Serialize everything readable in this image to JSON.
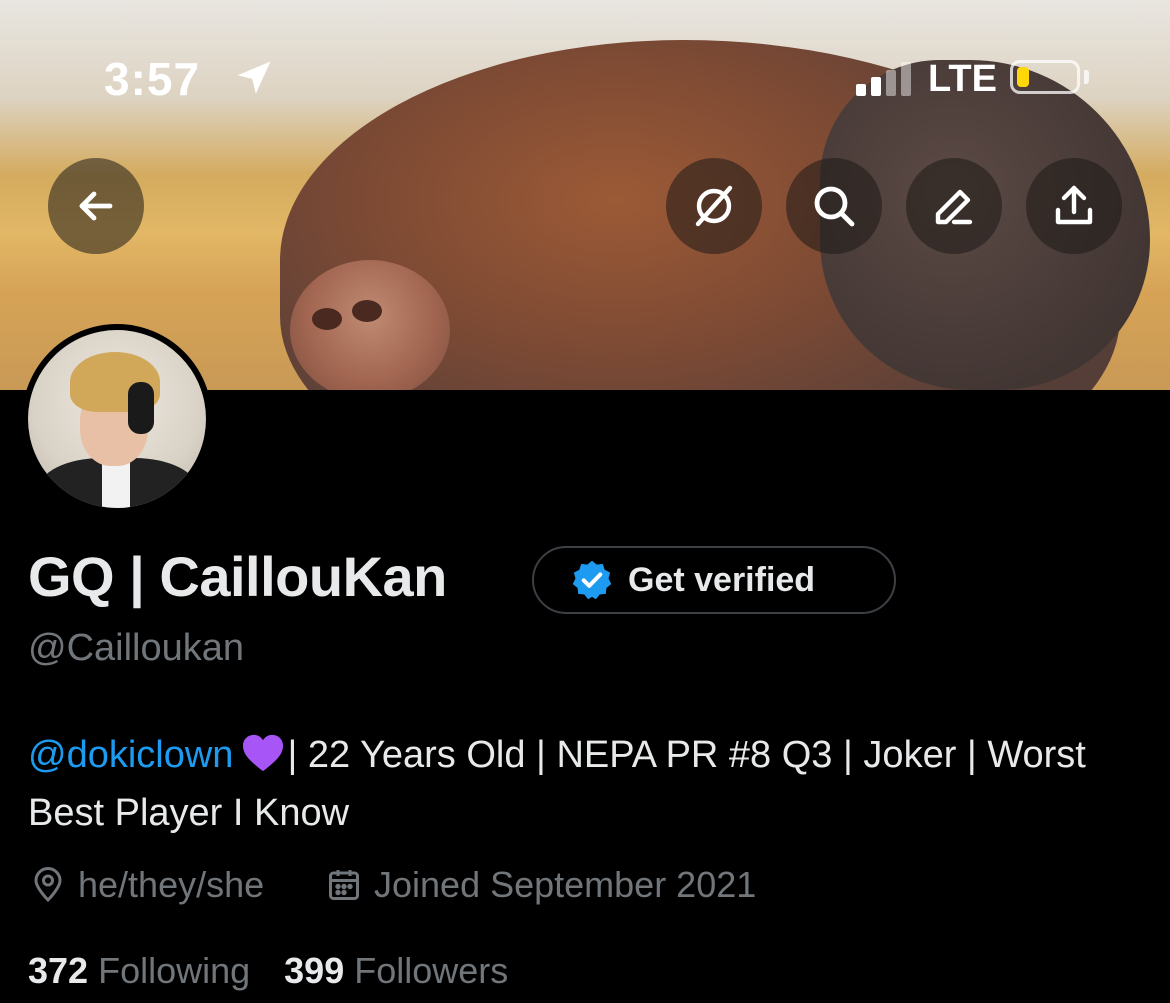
{
  "status_bar": {
    "time": "3:57",
    "network": "LTE",
    "battery_color": "#ffd60a"
  },
  "header": {
    "back_icon": "arrow-left-icon",
    "actions": [
      "grok-icon",
      "search-icon",
      "edit-icon",
      "share-icon"
    ]
  },
  "profile": {
    "display_name": "GQ | CaillouKan",
    "verify_button_label": "Get verified",
    "handle": "@Cailloukan",
    "bio_mention": "@dokiclown",
    "bio_text": "| 22 Years Old | NEPA PR #8 Q3 | Joker | Worst Best Player I Know",
    "pronouns": "he/they/she",
    "joined": "Joined September 2021",
    "following_count": "372",
    "following_label": "Following",
    "followers_count": "399",
    "followers_label": "Followers"
  },
  "colors": {
    "background": "#000000",
    "text_primary": "#e7e9ea",
    "text_secondary": "#71767b",
    "accent": "#1d9bf0",
    "heart": "#a855f7"
  }
}
